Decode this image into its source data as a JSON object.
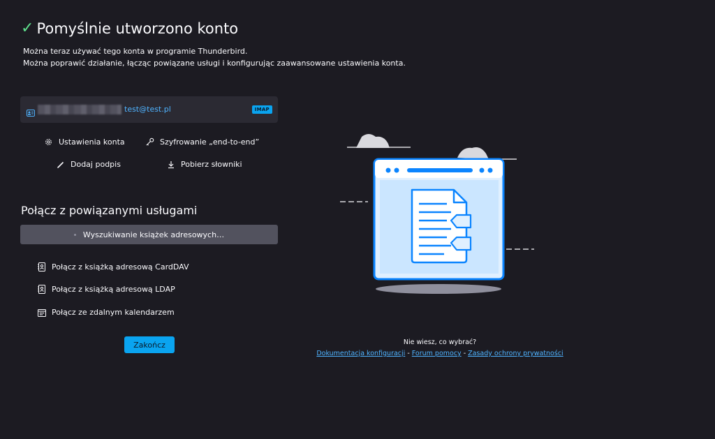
{
  "header": {
    "title": "Pomyślnie utworzono konto",
    "line1": "Można teraz używać tego konta w programie Thunderbird.",
    "line2": "Można poprawić działanie, łącząc powiązane usługi i konfigurując zaawansowane ustawienia konta."
  },
  "account": {
    "email": "test@test.pl",
    "protocol": "IMAP"
  },
  "actions": {
    "settings": "Ustawienia konta",
    "e2e": "Szyfrowanie „end-to-end”",
    "signature": "Dodaj podpis",
    "dictionaries": "Pobierz słowniki"
  },
  "services": {
    "title": "Połącz z powiązanymi usługami",
    "searching": "Wyszukiwanie książek adresowych…",
    "carddav": "Połącz z książką adresową CardDAV",
    "ldap": "Połącz z książką adresową LDAP",
    "calendar": "Połącz ze zdalnym kalendarzem"
  },
  "finish_label": "Zakończ",
  "help": {
    "question": "Nie wiesz, co wybrać?",
    "docs": "Dokumentacja konfiguracji",
    "forum": "Forum pomocy",
    "privacy": "Zasady ochrony prywatności",
    "separator": " - "
  },
  "colors": {
    "background": "#1c1b22",
    "accent": "#0aa4f0",
    "link": "#4fb3ff",
    "success": "#5ee08c"
  }
}
